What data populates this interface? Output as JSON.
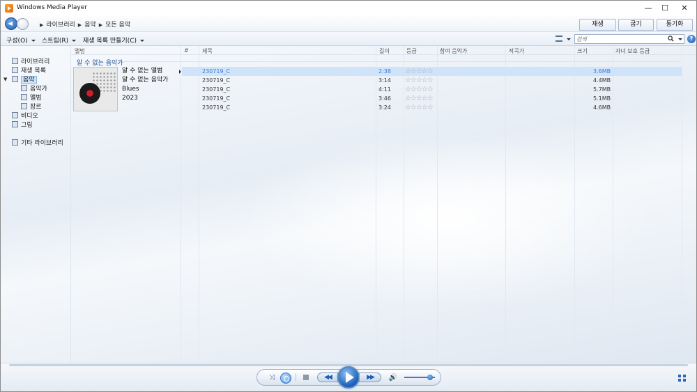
{
  "window": {
    "title": "Windows Media Player"
  },
  "titlebar": {
    "minimize": "—",
    "maximize": "☐",
    "close": "✕"
  },
  "breadcrumb": [
    "라이브러리",
    "음악",
    "모든 음악"
  ],
  "tabs": {
    "play": "재생",
    "burn": "굽기",
    "sync": "동기화"
  },
  "toolbar": {
    "organize": "구성(O)",
    "stream": "스트림(R)",
    "create_playlist": "재생 목록 만들기(C)",
    "search_placeholder": "검색",
    "help": "?"
  },
  "sidebar": {
    "library": "라이브러리",
    "playlists": "재생 목록",
    "music": "음악",
    "artist": "음악가",
    "album": "앨범",
    "genre": "장르",
    "videos": "비디오",
    "pictures": "그림",
    "other_libraries": "기타 라이브러리"
  },
  "columns": {
    "album": "앨범",
    "number": "#",
    "title": "제목",
    "length": "길이",
    "rating": "등급",
    "contributing_artist": "참여 음악가",
    "composer": "작곡가",
    "size": "크기",
    "parental_rating": "자녀 보호 등급"
  },
  "group": {
    "header": "알 수 없는 음악가",
    "album_name": "알 수 없는 앨범",
    "artist": "알 수 없는 음악가",
    "genre": "Blues",
    "year": "2023"
  },
  "tracks": [
    {
      "title": "230719_C",
      "length": "2:38",
      "rating": "☆☆☆☆☆",
      "size": "3.6MB"
    },
    {
      "title": "230719_C",
      "length": "3:14",
      "rating": "☆☆☆☆☆",
      "size": "4.4MB"
    },
    {
      "title": "230719_C",
      "length": "4:11",
      "rating": "☆☆☆☆☆",
      "size": "5.7MB"
    },
    {
      "title": "230719_C",
      "length": "3:46",
      "rating": "☆☆☆☆☆",
      "size": "5.1MB"
    },
    {
      "title": "230719_C",
      "length": "3:24",
      "rating": "☆☆☆☆☆",
      "size": "4.6MB"
    }
  ],
  "colors": {
    "accent": "#1f5fb8",
    "selection": "#cfe3fa",
    "playing_text": "#3c7dd1"
  }
}
